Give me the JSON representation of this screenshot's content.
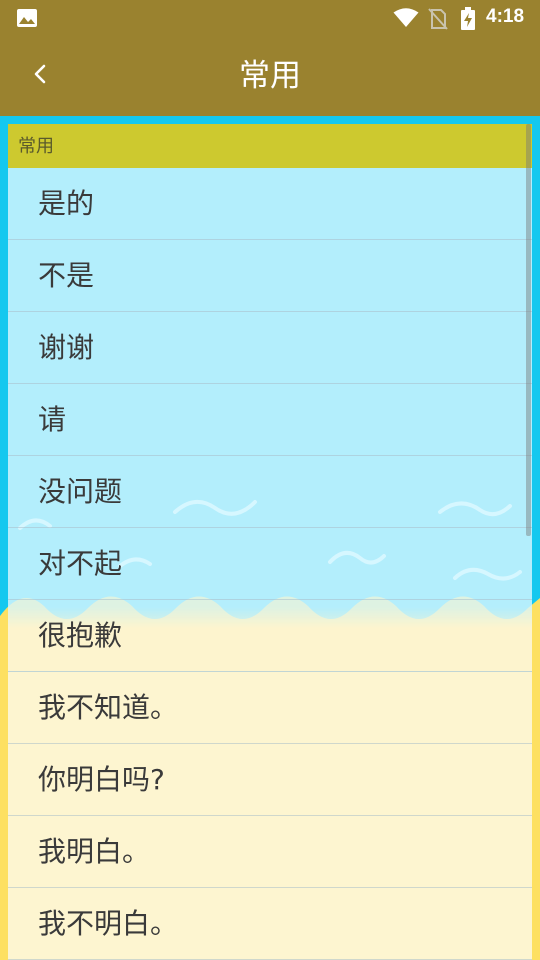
{
  "status_bar": {
    "time": "4:18"
  },
  "app_bar": {
    "title": "常用"
  },
  "section": {
    "title": "常用"
  },
  "phrases": [
    "是的",
    "不是",
    "谢谢",
    "请",
    "没问题",
    "对不起",
    "很抱歉",
    "我不知道。",
    "你明白吗?",
    "我明白。",
    "我不明白。"
  ],
  "colors": {
    "app_bar": "#9a822f",
    "section_header": "#cdc92f",
    "sky": "#14c8ef",
    "sand": "#fde061"
  },
  "icons": {
    "status_left": "gallery-icon",
    "wifi": "wifi-icon",
    "sim": "no-sim-icon",
    "battery": "battery-charging-icon",
    "back": "chevron-left-icon"
  }
}
